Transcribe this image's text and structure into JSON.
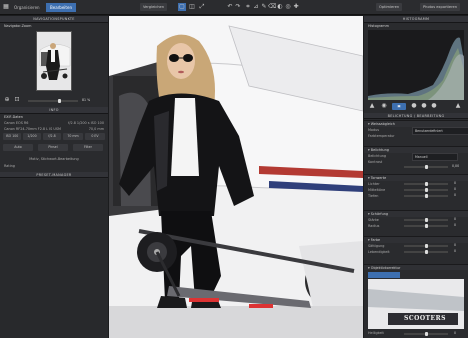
{
  "topbar": {
    "tabs": [
      "Organisieren",
      "Bearbeiten"
    ],
    "buttons": [
      "Vergleichen",
      "Optimieren",
      "Photos exportieren"
    ]
  },
  "left_panel": {
    "navigator_title": "NAVIGATIONSPUNKTE",
    "navigator_label": "Navigator-Zoom",
    "zoom_value": "81 %",
    "info_title": "INFO",
    "info_rows": [
      {
        "label": "EXIF-Daten",
        "value": ""
      },
      {
        "label": "Canon EOS R6",
        "value": "f/2.8  1/200 s  ISO 100"
      },
      {
        "label": "Canon RF24-70mm F2.8 L IS USM",
        "value": "70,0 mm"
      }
    ],
    "stat_buttons": [
      "ISO 100",
      "1/200",
      "f/2.8",
      "70 mm",
      "0 EV"
    ],
    "tool_buttons": [
      "Auto",
      "Pinsel",
      "Filter"
    ],
    "keywords": "Motiv, Stichwort-Bearbeitung",
    "rating": "Rating",
    "preset_title": "PRESET-MANAGER"
  },
  "right_panel": {
    "histogram_title": "HISTOGRAMM",
    "histogram_label": "Histogramm",
    "mode_title": "BELICHTUNG / BEARBEITUNG",
    "sections": [
      {
        "title": "Weissabgleich",
        "rows": [
          {
            "label": "Modus",
            "value": "Benutzerdefiniert"
          },
          {
            "label": "Farbtemperatur",
            "value": ""
          }
        ]
      },
      {
        "title": "Belichtung",
        "rows": [
          {
            "label": "Belichtung",
            "value": "Manuell"
          },
          {
            "label": "Kontrast",
            "value": "0,00"
          }
        ]
      },
      {
        "title": "Tonwerte",
        "rows": [
          {
            "label": "Lichter",
            "value": "0"
          },
          {
            "label": "Mitteltöne",
            "value": "0"
          },
          {
            "label": "Tiefen",
            "value": "0"
          }
        ]
      },
      {
        "title": "Schärfung",
        "rows": [
          {
            "label": "Stärke",
            "value": "0"
          },
          {
            "label": "Radius",
            "value": "0"
          }
        ]
      },
      {
        "title": "Farbe",
        "rows": [
          {
            "label": "Sättigung",
            "value": "0"
          },
          {
            "label": "Lebendigkeit",
            "value": "0"
          }
        ]
      }
    ],
    "lens_title": "Objektivkorrektur",
    "preview_text": "SCOOTERS",
    "bottom_label": "Helligkeit",
    "bottom_value": "0"
  },
  "colors": {
    "accent": "#3d6fb0",
    "panel": "#2a2b2e",
    "bg": "#1b1c1e"
  }
}
